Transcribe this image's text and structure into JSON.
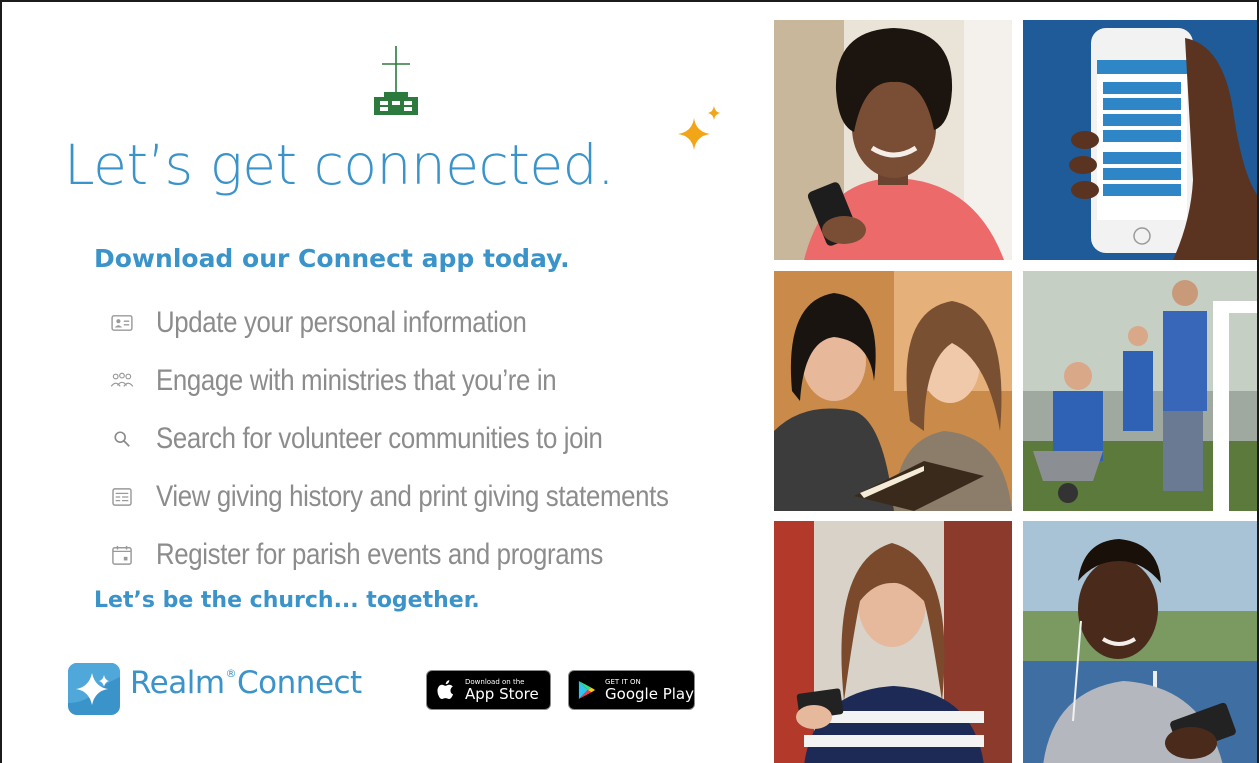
{
  "headline": "Let’s get connected.",
  "subhead": "Download our Connect app today.",
  "features": [
    {
      "icon": "id-card-icon",
      "text": "Update your personal information"
    },
    {
      "icon": "group-icon",
      "text": "Engage with ministries that you’re in"
    },
    {
      "icon": "search-icon",
      "text": "Search for volunteer communities to join"
    },
    {
      "icon": "statement-icon",
      "text": "View giving history and print giving statements"
    },
    {
      "icon": "calendar-icon",
      "text": "Register for parish events and programs"
    }
  ],
  "tagline": "Let’s be the church... together.",
  "brand": {
    "name_part1": "Realm",
    "reg_mark": "®",
    "name_part2": "Connect"
  },
  "badges": {
    "appstore_small": "Download on the",
    "appstore_big": "App Store",
    "googleplay_small": "GET IT ON",
    "googleplay_big": "Google Play"
  },
  "colors": {
    "accent": "#3a93c9",
    "feature_text": "#8c8c8c",
    "logo_green": "#2d7a3e",
    "sparkle": "#f2a516"
  }
}
